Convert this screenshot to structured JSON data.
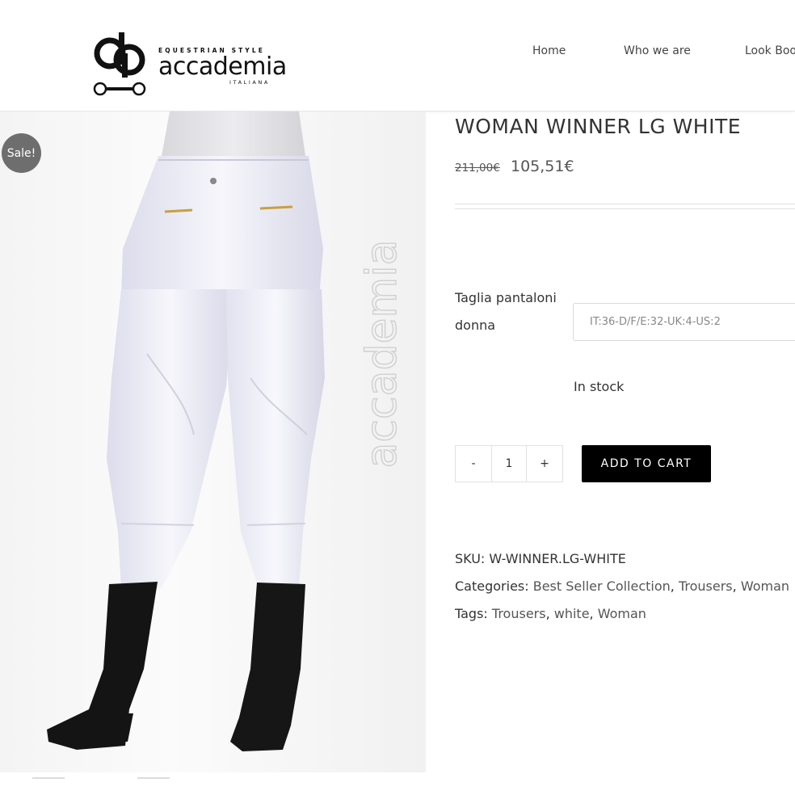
{
  "header": {
    "logo": {
      "tagline": "EQUESTRIAN STYLE",
      "name": "accademia",
      "subline": "ITALIANA"
    },
    "nav": [
      {
        "label": "Home"
      },
      {
        "label": "Who we are"
      },
      {
        "label": "Look Book"
      }
    ]
  },
  "product": {
    "sale_badge": "Sale!",
    "watermark": "accademia",
    "title": "WOMAN WINNER LG WHITE",
    "price_old": "211,00€",
    "price_new": "105,51€",
    "variation": {
      "label": "Taglia pantaloni donna",
      "selected": "IT:36-D/F/E:32-UK:4-US:2"
    },
    "stock": "In stock",
    "quantity": {
      "minus": "-",
      "value": "1",
      "plus": "+"
    },
    "add_to_cart": "ADD TO CART",
    "meta": {
      "sku_label": "SKU:",
      "sku": "W-WINNER.LG-WHITE",
      "categories_label": "Categories:",
      "categories": [
        "Best Seller Collection",
        "Trousers",
        "Woman"
      ],
      "tags_label": "Tags:",
      "tags": [
        "Trousers",
        "white",
        "Woman"
      ]
    }
  },
  "colors": {
    "button_bg": "#000000",
    "badge_bg": "#6e6e6e",
    "text": "#333333"
  }
}
